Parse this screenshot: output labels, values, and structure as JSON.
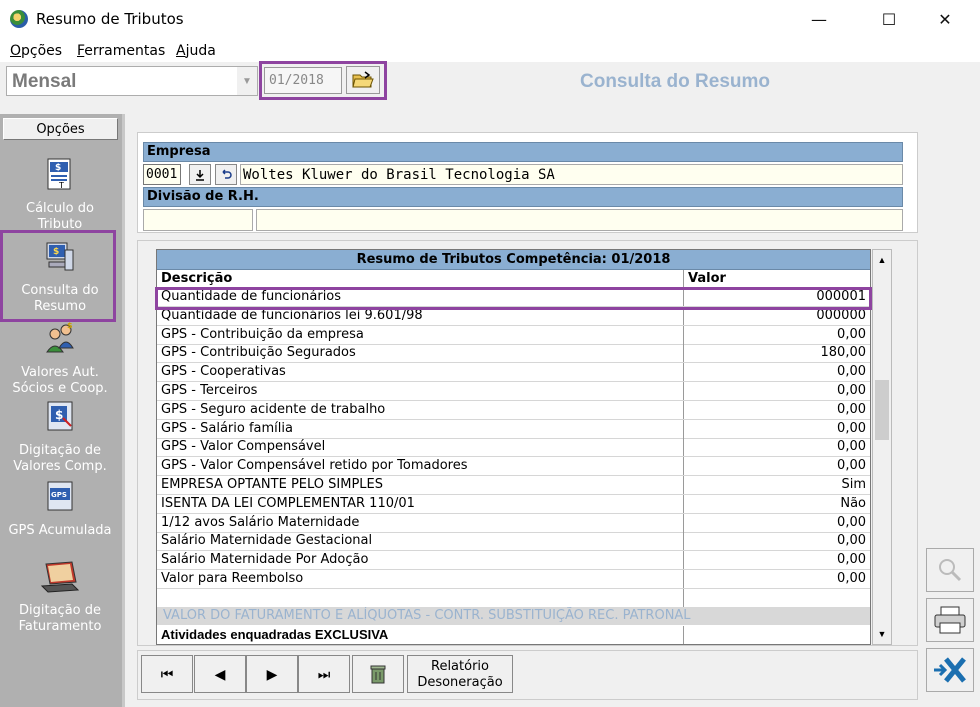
{
  "window": {
    "title": "Resumo de Tributos",
    "minimize": "—",
    "maximize": "☐",
    "close": "✕"
  },
  "menu": [
    {
      "label": "Opções",
      "accel": "O",
      "rest": "pções"
    },
    {
      "label": "Ferramentas",
      "accel": "F",
      "rest": "erramentas"
    },
    {
      "label": "Ajuda",
      "accel": "A",
      "rest": "juda"
    }
  ],
  "toolbar": {
    "period_value": "Mensal",
    "date_value": "01/2018",
    "header_title": "Consulta do Resumo"
  },
  "left_panel": {
    "tab_label": "Opções",
    "items": [
      {
        "label": "Cálculo do Tributo",
        "icon": "calc-doc-icon"
      },
      {
        "label": "Consulta do Resumo",
        "icon": "computer-search-icon"
      },
      {
        "label": "Valores Aut. Sócios e Coop.",
        "icon": "people-money-icon"
      },
      {
        "label": "Digitação de Valores Comp.",
        "icon": "dollar-doc-icon"
      },
      {
        "label": "GPS Acumulada",
        "icon": "gps-doc-icon"
      },
      {
        "label": "Digitação de Faturamento",
        "icon": "laptop-icon"
      }
    ]
  },
  "empresa": {
    "header": "Empresa",
    "code": "0001",
    "name": "Woltes Kluwer do Brasil Tecnologia SA",
    "divisao_header": "Divisão de R.H."
  },
  "table": {
    "title": "Resumo de Tributos Competência: 01/2018",
    "col_desc": "Descrição",
    "col_valor": "Valor",
    "rows": [
      {
        "desc": "Quantidade de funcionários",
        "valor": "000001"
      },
      {
        "desc": "Quantidade de funcionários lei 9.601/98",
        "valor": "000000"
      },
      {
        "desc": "GPS - Contribuição da empresa",
        "valor": "0,00"
      },
      {
        "desc": "GPS - Contribuição Segurados",
        "valor": "180,00"
      },
      {
        "desc": "GPS - Cooperativas",
        "valor": "0,00"
      },
      {
        "desc": "GPS - Terceiros",
        "valor": "0,00"
      },
      {
        "desc": "GPS - Seguro acidente de trabalho",
        "valor": "0,00"
      },
      {
        "desc": "GPS - Salário família",
        "valor": "0,00"
      },
      {
        "desc": "GPS - Valor Compensável",
        "valor": "0,00"
      },
      {
        "desc": "GPS - Valor Compensável retido por Tomadores",
        "valor": "0,00"
      },
      {
        "desc": "EMPRESA OPTANTE PELO SIMPLES",
        "valor": "Sim"
      },
      {
        "desc": "ISENTA DA LEI COMPLEMENTAR 110/01",
        "valor": "Não"
      },
      {
        "desc": "1/12 avos Salário Maternidade",
        "valor": "0,00"
      },
      {
        "desc": "Salário Maternidade Gestacional",
        "valor": "0,00"
      },
      {
        "desc": "Salário Maternidade Por Adoção",
        "valor": "0,00"
      },
      {
        "desc": "Valor para Reembolso",
        "valor": "0,00"
      },
      {
        "desc": "",
        "valor": ""
      }
    ],
    "separator": "VALOR DO FATURAMENTO E ALÍQUOTAS - CONTR. SUBSTITUIÇÃO REC. PATRONAL",
    "last_row": "Atividades enquadradas EXCLUSIVA"
  },
  "bottom_nav": {
    "first": "⏮",
    "prev": "◀",
    "next": "▶",
    "last": "⏭",
    "relatorio": "Relatório Desoneração"
  }
}
